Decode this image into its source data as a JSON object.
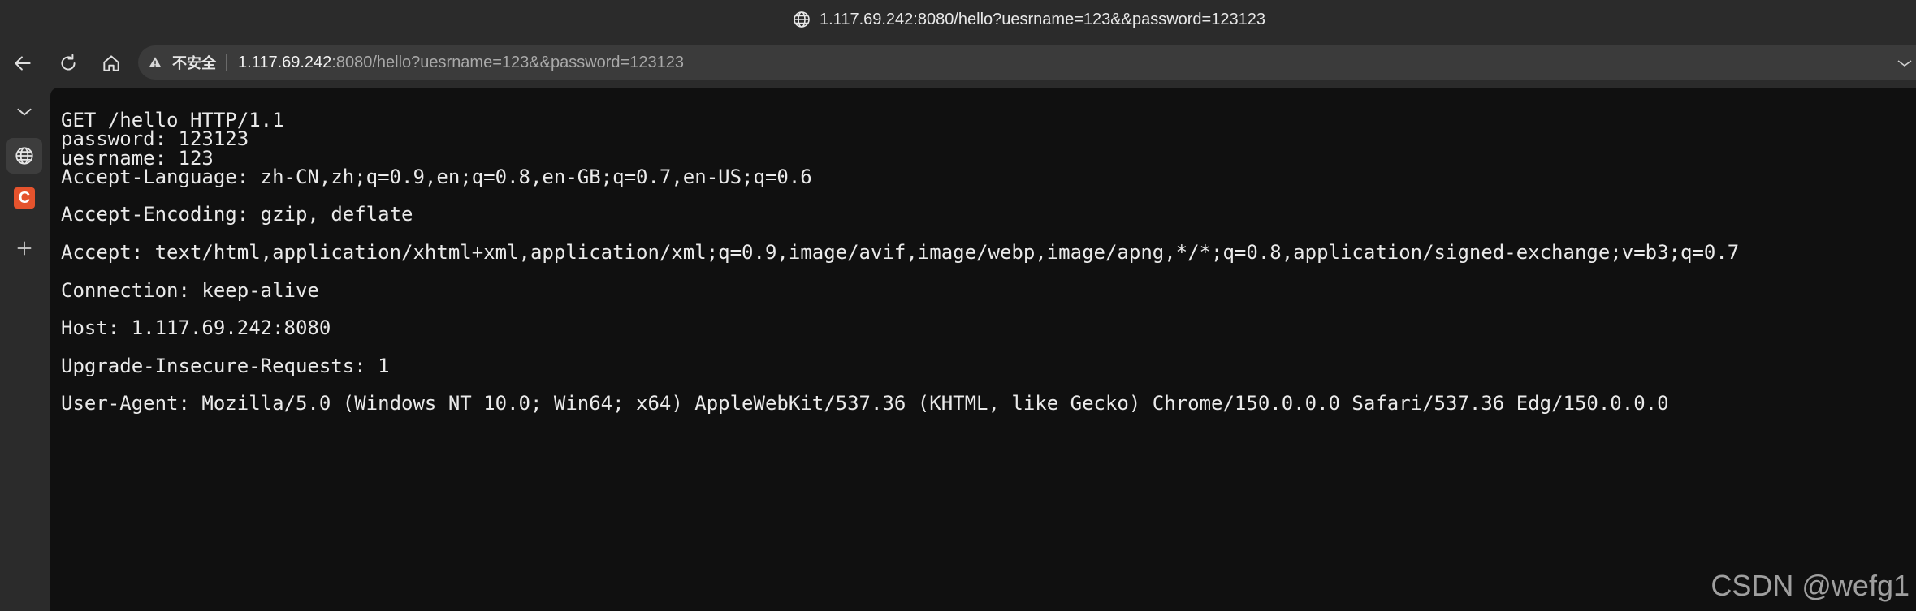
{
  "window": {
    "title": "1.117.69.242:8080/hello?uesrname=123&&password=123123",
    "title_icon": "globe-icon"
  },
  "toolbar": {
    "back_icon": "back-arrow-icon",
    "refresh_icon": "refresh-icon",
    "home_icon": "home-icon"
  },
  "addressbar": {
    "security_icon": "warning-triangle-icon",
    "security_label": "不安全",
    "url_host": "1.117.69.242",
    "url_rest": ":8080/hello?uesrname=123&&password=123123"
  },
  "sidebar": {
    "items": [
      {
        "name": "collapse",
        "icon": "chevron-down-icon"
      },
      {
        "name": "globe",
        "icon": "globe-icon",
        "active": true
      },
      {
        "name": "csdn",
        "icon": "csdn-icon",
        "label": "C"
      },
      {
        "name": "add",
        "icon": "plus-icon"
      }
    ]
  },
  "content": {
    "text": "GET /hello HTTP/1.1\npassword: 123123\nuesrname: 123\nAccept-Language: zh-CN,zh;q=0.9,en;q=0.8,en-GB;q=0.7,en-US;q=0.6\n\nAccept-Encoding: gzip, deflate\n\nAccept: text/html,application/xhtml+xml,application/xml;q=0.9,image/avif,image/webp,image/apng,*/*;q=0.8,application/signed-exchange;v=b3;q=0.7\n\nConnection: keep-alive\n\nHost: 1.117.69.242:8080\n\nUpgrade-Insecure-Requests: 1\n\nUser-Agent: Mozilla/5.0 (Windows NT 10.0; Win64; x64) AppleWebKit/537.36 (KHTML, like Gecko) Chrome/150.0.0.0 Safari/537.36 Edg/150.0.0.0"
  },
  "watermark": "CSDN @wefg1",
  "colors": {
    "chrome_bg": "#2b2b2b",
    "content_bg": "#101010",
    "text": "#eaeaea",
    "csdn_red": "#e5532d"
  }
}
